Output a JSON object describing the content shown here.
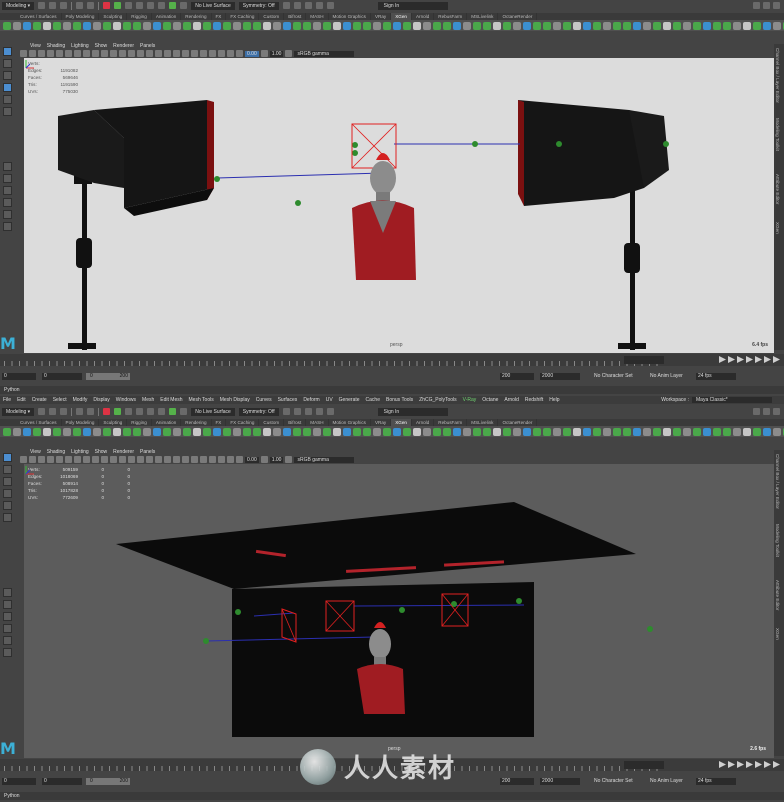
{
  "top_window": {
    "status_line": {
      "mode": "Modeling",
      "live_surface": "No Live Surface",
      "symmetry": "Symmetry: Off",
      "sign_in": "Sign In"
    },
    "shelf_tabs": [
      "Curves / Surfaces",
      "Poly Modeling",
      "Sculpting",
      "Rigging",
      "Animation",
      "Rendering",
      "FX",
      "FX Caching",
      "Custom",
      "Bifrost",
      "MASH",
      "Motion Graphics",
      "VRay",
      "XGen",
      "Arnold",
      "RebusFarm",
      "MSLivelink",
      "OctaneRender"
    ],
    "active_shelf_tab": "XGen",
    "panel_menu": [
      "View",
      "Shading",
      "Lighting",
      "Show",
      "Renderer",
      "Panels"
    ],
    "panel_values": {
      "v1": "0.00",
      "v2": "1.00",
      "gamma": "sRGB gamma"
    },
    "hud": {
      "rows": [
        {
          "label": "Verts:",
          "value": "",
          "a": "",
          "b": ""
        },
        {
          "label": "Edges:",
          "value": "1191082",
          "a": "",
          "b": ""
        },
        {
          "label": "Faces:",
          "value": "569646",
          "a": "",
          "b": ""
        },
        {
          "label": "Tris:",
          "value": "1191590",
          "a": "",
          "b": ""
        },
        {
          "label": "UVs:",
          "value": "775030",
          "a": "",
          "b": ""
        }
      ]
    },
    "camera": "persp",
    "fps": "6.4 fps",
    "side_tabs": [
      "Channel Box / Layer Editor",
      "Modeling Toolkit",
      "Attribute Editor",
      "XGen"
    ],
    "range": {
      "start": "0",
      "inner_start": "0",
      "slider_end": "200",
      "end_inner": "200",
      "end": "2000"
    },
    "character_set": "No Character Set",
    "anim_layer": "No Anim Layer",
    "fps_setting": "24 fps",
    "script_lang": "Python"
  },
  "bottom_window": {
    "menu": [
      "File",
      "Edit",
      "Create",
      "Select",
      "Modify",
      "Display",
      "Windows",
      "Mesh",
      "Edit Mesh",
      "Mesh Tools",
      "Mesh Display",
      "Curves",
      "Surfaces",
      "Deform",
      "UV",
      "Generate",
      "Cache",
      "Bonus Tools",
      "ZhCG_PolyTools",
      "V-Ray",
      "Octane",
      "Arnold",
      "Redshift",
      "Help"
    ],
    "workspace_label": "Workspace :",
    "workspace": "Maya Classic*",
    "status_line": {
      "mode": "Modeling",
      "live_surface": "No Live Surface",
      "symmetry": "Symmetry: Off",
      "sign_in": "Sign In"
    },
    "shelf_tabs": [
      "Curves / Surfaces",
      "Poly Modeling",
      "Sculpting",
      "Rigging",
      "Animation",
      "Rendering",
      "FX",
      "FX Caching",
      "Custom",
      "Bifrost",
      "MASH",
      "Motion Graphics",
      "VRay",
      "XGen",
      "Arnold",
      "RebusFarm",
      "MSLivelink",
      "OctaneRender"
    ],
    "active_shelf_tab": "XGen",
    "panel_menu": [
      "View",
      "Shading",
      "Lighting",
      "Show",
      "Renderer",
      "Panels"
    ],
    "panel_values": {
      "v1": "0.00",
      "v2": "1.00",
      "gamma": "sRGB gamma"
    },
    "hud": {
      "rows": [
        {
          "label": "Verts:",
          "value": "509159",
          "a": "0",
          "b": "0"
        },
        {
          "label": "Edges:",
          "value": "1018069",
          "a": "0",
          "b": "0"
        },
        {
          "label": "Faces:",
          "value": "508914",
          "a": "0",
          "b": "0"
        },
        {
          "label": "Tris:",
          "value": "1017828",
          "a": "0",
          "b": "0"
        },
        {
          "label": "UVs:",
          "value": "772609",
          "a": "0",
          "b": "0"
        }
      ]
    },
    "camera": "persp",
    "fps": "2.6 fps",
    "side_tabs": [
      "Channel Box / Layer Editor",
      "Modeling Toolkit",
      "Attribute Editor",
      "XGen"
    ],
    "range": {
      "start": "0",
      "inner_start": "0",
      "slider_end": "200",
      "end_inner": "200",
      "end": "2000"
    },
    "character_set": "No Character Set",
    "anim_layer": "No Anim Layer",
    "fps_setting": "24 fps",
    "script_lang": "Python"
  },
  "watermark": {
    "text": "人人素材"
  },
  "colors": {
    "ui_bg": "#444444",
    "viewport_light": "#dcdcdc",
    "viewport_dark": "#5a5a5a",
    "accent_green": "#55b14a",
    "mesh_red": "#b3232b"
  }
}
